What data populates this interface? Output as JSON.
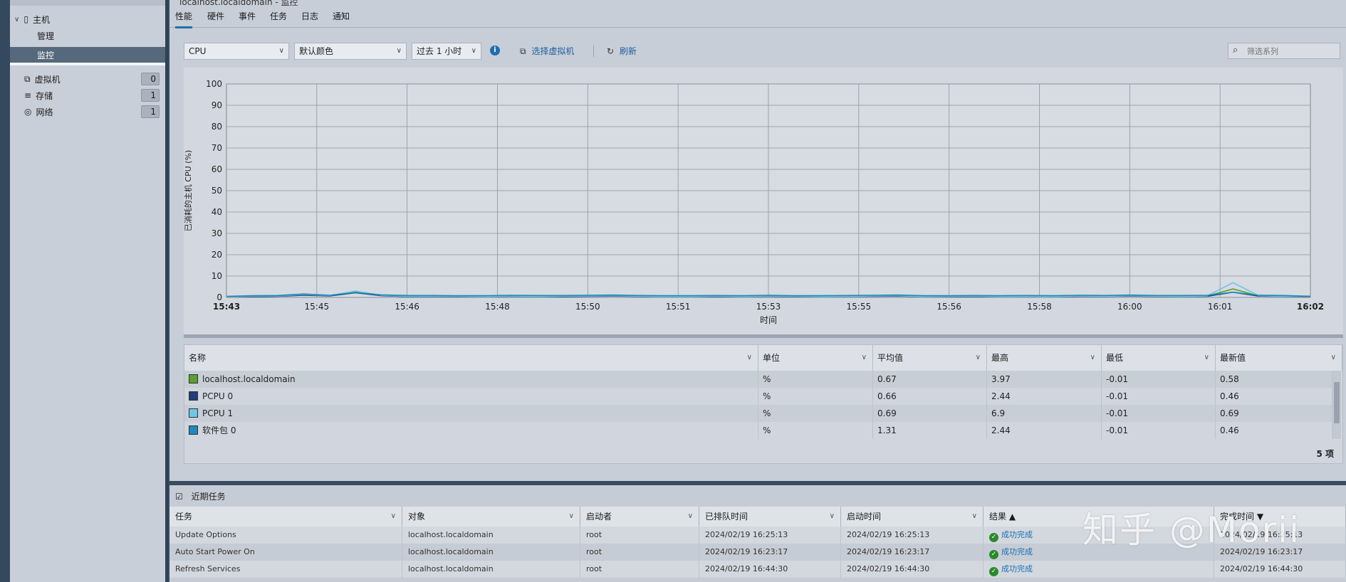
{
  "breadcrumb": "localhost.localdomain - 监控",
  "left_nav": {
    "items": [
      {
        "label": "主机",
        "type": "group"
      },
      {
        "label": "管理",
        "type": "sub"
      },
      {
        "label": "监控",
        "type": "sub",
        "selected": true
      }
    ],
    "counts": [
      {
        "label": "虚拟机",
        "count": "0",
        "icon": "vm-icon"
      },
      {
        "label": "存储",
        "count": "1",
        "icon": "storage-icon"
      },
      {
        "label": "网络",
        "count": "1",
        "icon": "network-icon"
      }
    ]
  },
  "tabs": [
    "性能",
    "硬件",
    "事件",
    "任务",
    "日志",
    "通知"
  ],
  "toolbar": {
    "metric": "CPU",
    "colors": "默认颜色",
    "range": "过去 1 小时",
    "select_vm": "选择虚拟机",
    "refresh": "刷新",
    "filter_placeholder": "筛选系列"
  },
  "chart_data": {
    "type": "line",
    "ylabel": "已消耗的主机 CPU (%)",
    "xlabel": "时间",
    "ylim": [
      0,
      100
    ],
    "yticks": [
      0,
      10,
      20,
      30,
      40,
      50,
      60,
      70,
      80,
      90,
      100
    ],
    "xticks": [
      "15:43",
      "15:45",
      "15:46",
      "15:48",
      "15:50",
      "15:51",
      "15:53",
      "15:55",
      "15:56",
      "15:58",
      "16:00",
      "16:01",
      "16:02"
    ],
    "grid": true,
    "series": [
      {
        "name": "localhost.localdomain",
        "color": "#5aa02c",
        "values": [
          0.3,
          0.5,
          0.6,
          1.2,
          0.8,
          2.6,
          0.9,
          0.4,
          0.5,
          0.4,
          0.4,
          0.6,
          0.5,
          0.5,
          0.6,
          0.7,
          0.5,
          0.4,
          0.4,
          0.5,
          0.4,
          0.6,
          0.4,
          0.4,
          0.5,
          0.6,
          0.7,
          0.4,
          0.4,
          0.5,
          0.4,
          0.5,
          0.4,
          0.6,
          0.5,
          0.7,
          0.5,
          0.5,
          0.6,
          3.97,
          0.7,
          0.5,
          0.58
        ]
      },
      {
        "name": "PCPU 0",
        "color": "#1d3f7a",
        "values": [
          0.3,
          0.4,
          0.5,
          1.0,
          0.7,
          2.2,
          0.8,
          0.4,
          0.4,
          0.4,
          0.4,
          0.5,
          0.5,
          0.4,
          0.5,
          0.6,
          0.5,
          0.4,
          0.4,
          0.4,
          0.4,
          0.5,
          0.4,
          0.4,
          0.5,
          0.5,
          0.6,
          0.4,
          0.4,
          0.4,
          0.4,
          0.5,
          0.4,
          0.5,
          0.5,
          0.6,
          0.5,
          0.5,
          0.5,
          2.44,
          0.6,
          0.5,
          0.46
        ]
      },
      {
        "name": "PCPU 1",
        "color": "#6cc7e8",
        "values": [
          0.3,
          0.6,
          0.7,
          1.4,
          0.9,
          3.0,
          1.0,
          0.5,
          0.5,
          0.5,
          0.4,
          0.7,
          0.5,
          0.6,
          0.7,
          0.8,
          0.6,
          0.4,
          0.4,
          0.6,
          0.4,
          0.7,
          0.5,
          0.4,
          0.5,
          0.7,
          0.8,
          0.4,
          0.5,
          0.6,
          0.4,
          0.5,
          0.4,
          0.7,
          0.5,
          0.8,
          0.6,
          0.5,
          0.7,
          6.9,
          0.8,
          0.5,
          0.69
        ]
      },
      {
        "name": "软件包 0",
        "color": "#1f8ab8",
        "values": [
          0.5,
          0.8,
          0.9,
          1.6,
          1.0,
          2.3,
          1.2,
          0.9,
          0.9,
          0.8,
          0.8,
          1.0,
          0.9,
          0.9,
          1.0,
          1.1,
          0.9,
          0.8,
          0.8,
          0.9,
          0.8,
          1.0,
          0.8,
          0.8,
          0.9,
          1.0,
          1.1,
          0.8,
          0.8,
          0.9,
          0.8,
          0.9,
          0.8,
          1.0,
          0.9,
          1.1,
          0.9,
          0.9,
          1.0,
          2.44,
          1.0,
          0.9,
          0.46
        ]
      }
    ]
  },
  "table": {
    "headers": [
      "名称",
      "单位",
      "平均值",
      "最高",
      "最低",
      "最新值"
    ],
    "rows": [
      {
        "name": "localhost.localdomain",
        "color": "#5aa02c",
        "unit": "%",
        "avg": "0.67",
        "max": "3.97",
        "min": "-0.01",
        "latest": "0.58"
      },
      {
        "name": "PCPU 0",
        "color": "#1d3f7a",
        "unit": "%",
        "avg": "0.66",
        "max": "2.44",
        "min": "-0.01",
        "latest": "0.46"
      },
      {
        "name": "PCPU 1",
        "color": "#6cc7e8",
        "unit": "%",
        "avg": "0.69",
        "max": "6.9",
        "min": "-0.01",
        "latest": "0.69"
      },
      {
        "name": "软件包 0",
        "color": "#1f8ab8",
        "unit": "%",
        "avg": "1.31",
        "max": "2.44",
        "min": "-0.01",
        "latest": "0.46"
      }
    ],
    "count": "5 项"
  },
  "recent_tasks": {
    "title": "近期任务",
    "headers": [
      "任务",
      "对象",
      "启动者",
      "已排队时间",
      "启动时间",
      "结果 ▲",
      "完成时间 ▼"
    ],
    "rows": [
      {
        "task": "Update Options",
        "object": "localhost.localdomain",
        "initiator": "root",
        "queued": "2024/02/19 16:25:13",
        "started": "2024/02/19 16:25:13",
        "result": "成功完成",
        "completed": "2024/02/19 16:25:13"
      },
      {
        "task": "Auto Start Power On",
        "object": "localhost.localdomain",
        "initiator": "root",
        "queued": "2024/02/19 16:23:17",
        "started": "2024/02/19 16:23:17",
        "result": "成功完成",
        "completed": "2024/02/19 16:23:17"
      },
      {
        "task": "Refresh Services",
        "object": "localhost.localdomain",
        "initiator": "root",
        "queued": "2024/02/19 16:44:30",
        "started": "2024/02/19 16:44:30",
        "result": "成功完成",
        "completed": "2024/02/19 16:44:30"
      }
    ]
  },
  "watermark": "知乎 @Morii"
}
